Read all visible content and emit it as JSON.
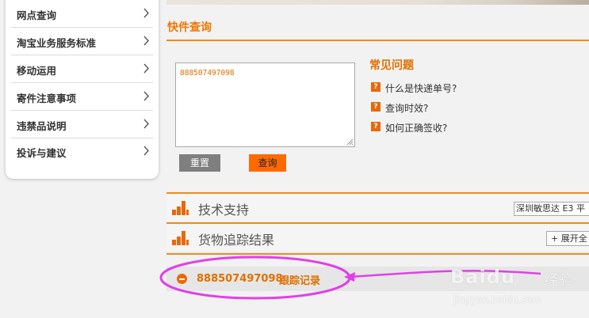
{
  "sidebar": {
    "items": [
      {
        "label": "网点查询"
      },
      {
        "label": "淘宝业务服务标准"
      },
      {
        "label": "移动运用"
      },
      {
        "label": "寄件注意事项"
      },
      {
        "label": "违禁品说明"
      },
      {
        "label": "投诉与建议"
      }
    ]
  },
  "query": {
    "section_title": "快件查询",
    "tracking_input_value": "888507497098",
    "reset_label": "重置",
    "submit_label": "查询"
  },
  "faq": {
    "title": "常见问题",
    "items": [
      {
        "label": "什么是快递单号?"
      },
      {
        "label": "查询时效?"
      },
      {
        "label": "如何正确签收?"
      }
    ]
  },
  "support_bar": {
    "title": "技术支持",
    "company_select_value": "深圳敏思达 E3 平"
  },
  "result_bar": {
    "title": "货物追踪结果",
    "expand_label": "+ 展开全"
  },
  "tracking_result": {
    "number": "888507497098",
    "label": "跟踪记录"
  },
  "watermark": {
    "brand": "Baidu",
    "brand_cn": "经验",
    "url": "jingyan.baidu.com"
  },
  "colors": {
    "accent": "#ee7700",
    "query_button": "#ff6a00",
    "reset_button": "#7f7f7f",
    "annotation": "#e040e8"
  },
  "icons": [
    "chevron-right-icon",
    "question-icon",
    "bar-chart-icon",
    "collapse-minus-icon"
  ]
}
